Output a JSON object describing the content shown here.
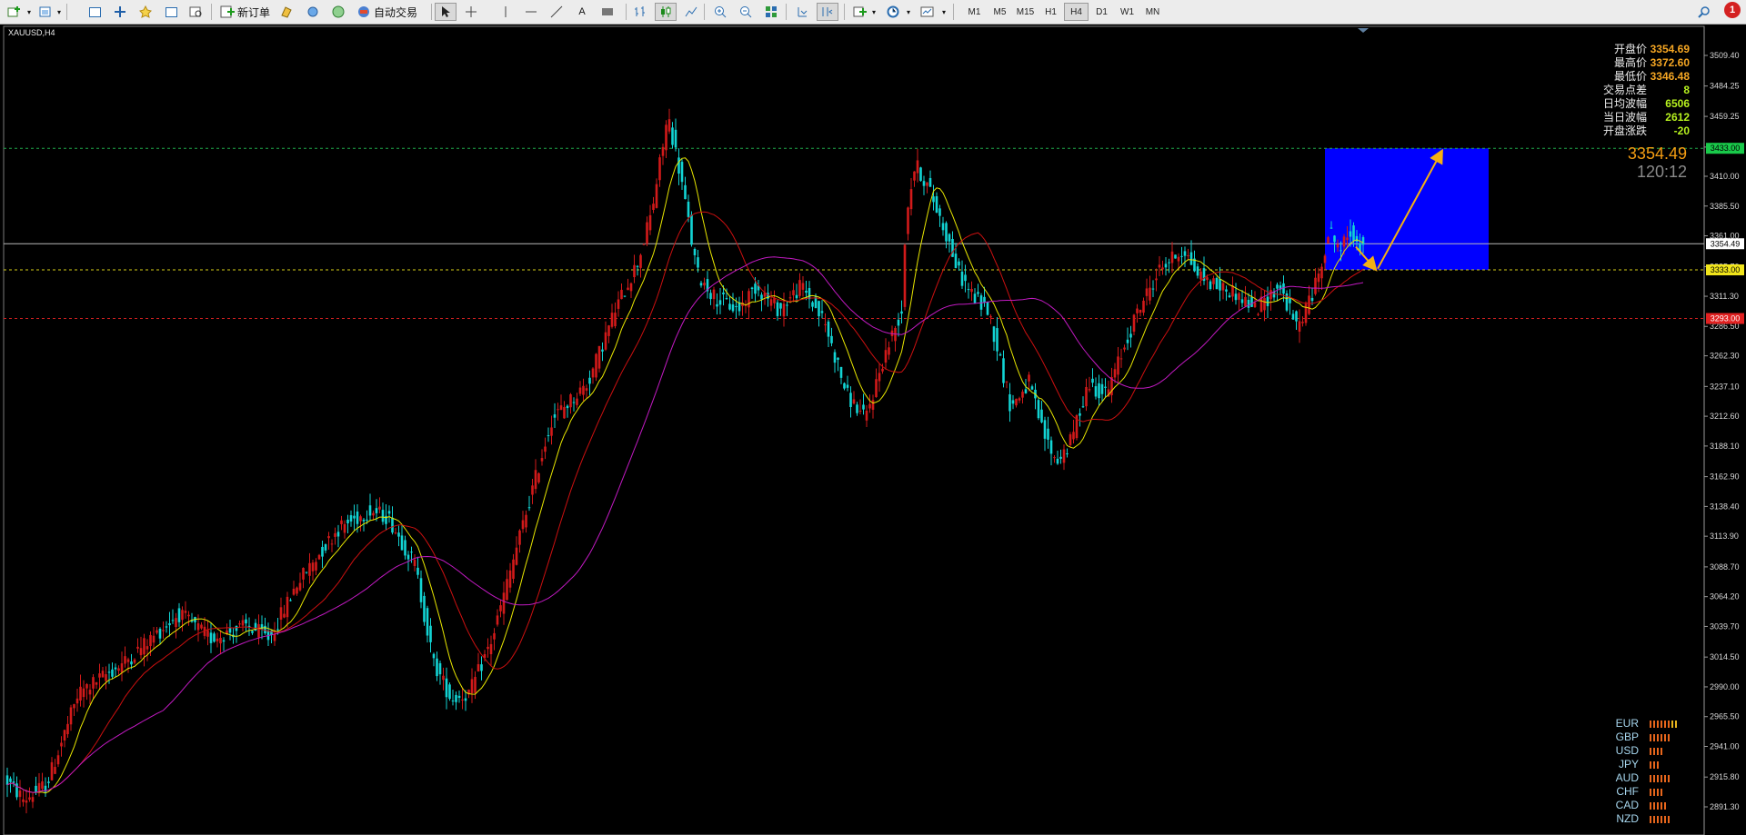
{
  "toolbar": {
    "new_order_label": "新订单",
    "auto_trade_label": "自动交易",
    "timeframes": [
      "M1",
      "M5",
      "M15",
      "H1",
      "H4",
      "D1",
      "W1",
      "MN"
    ],
    "active_timeframe": "H4",
    "notification_count": "1"
  },
  "chart": {
    "symbol_label": "XAUUSD,H4",
    "y_axis_labels": [
      "3509.40",
      "3484.25",
      "3459.25",
      "3434.00",
      "3410.00",
      "3385.50",
      "3361.00",
      "3335.70",
      "3311.30",
      "3286.50",
      "3262.30",
      "3237.10",
      "3212.60",
      "3188.10",
      "3162.90",
      "3138.40",
      "3113.90",
      "3088.70",
      "3064.20",
      "3039.70",
      "3014.50",
      "2990.00",
      "2965.50",
      "2941.00",
      "2915.80",
      "2891.30"
    ],
    "y_axis_values": [
      3509.4,
      3484.25,
      3459.25,
      3434.0,
      3410.0,
      3385.5,
      3361.0,
      3335.7,
      3311.3,
      3286.5,
      3262.3,
      3237.1,
      3212.6,
      3188.1,
      3162.9,
      3138.4,
      3113.9,
      3088.7,
      3064.2,
      3039.7,
      3014.5,
      2990.0,
      2965.5,
      2941.0,
      2915.8,
      2891.3
    ],
    "level_labels": [
      {
        "text": "3433.00",
        "value": 3433.0,
        "color": "#19c94a",
        "text_color": "#000000"
      },
      {
        "text": "3354.49",
        "value": 3354.49,
        "color": "#ffffff",
        "text_color": "#000000"
      },
      {
        "text": "3333.00",
        "value": 3333.0,
        "color": "#f1e51b",
        "text_color": "#000000"
      },
      {
        "text": "3293.00",
        "value": 3293.0,
        "color": "#e02020",
        "text_color": "#ffffff"
      }
    ],
    "levels": [
      {
        "value": 3433.0,
        "color": "#1fa84a",
        "style": "dash"
      },
      {
        "value": 3354.49,
        "color": "#b8b8b8",
        "style": "solid"
      },
      {
        "value": 3333.0,
        "color": "#d9cf18",
        "style": "dash"
      },
      {
        "value": 3293.0,
        "color": "#d02020",
        "style": "dash"
      }
    ],
    "projection_box": {
      "top_value": 3433.0,
      "bottom_value": 3333.0,
      "color": "#0000ff"
    },
    "colors": {
      "bull": "#d21a1a",
      "bear": "#12d4d4",
      "ma_fast": "#e8e600",
      "ma_mid": "#cc1010",
      "ma_slow": "#c21ac2",
      "arrow": "#f4b013"
    },
    "stats": [
      {
        "label": "开盘价",
        "value": "3354.69",
        "color": "#f5a623"
      },
      {
        "label": "最高价",
        "value": "3372.60",
        "color": "#f5a623"
      },
      {
        "label": "最低价",
        "value": "3346.48",
        "color": "#f5a623"
      },
      {
        "label": "交易点差",
        "value": "8",
        "color": "#b7f21f"
      },
      {
        "label": "日均波幅",
        "value": "6506",
        "color": "#b7f21f"
      },
      {
        "label": "当日波幅",
        "value": "2612",
        "color": "#b7f21f"
      },
      {
        "label": "开盘涨跌",
        "value": "-20",
        "color": "#b7f21f"
      }
    ],
    "current_price": "3354.49",
    "bar_timer": "120:12",
    "currency_strength": [
      {
        "label": "EUR",
        "bars": 8
      },
      {
        "label": "GBP",
        "bars": 6
      },
      {
        "label": "USD",
        "bars": 4
      },
      {
        "label": "JPY",
        "bars": 3
      },
      {
        "label": "AUD",
        "bars": 6
      },
      {
        "label": "CHF",
        "bars": 4
      },
      {
        "label": "CAD",
        "bars": 5
      },
      {
        "label": "NZD",
        "bars": 6
      }
    ]
  }
}
